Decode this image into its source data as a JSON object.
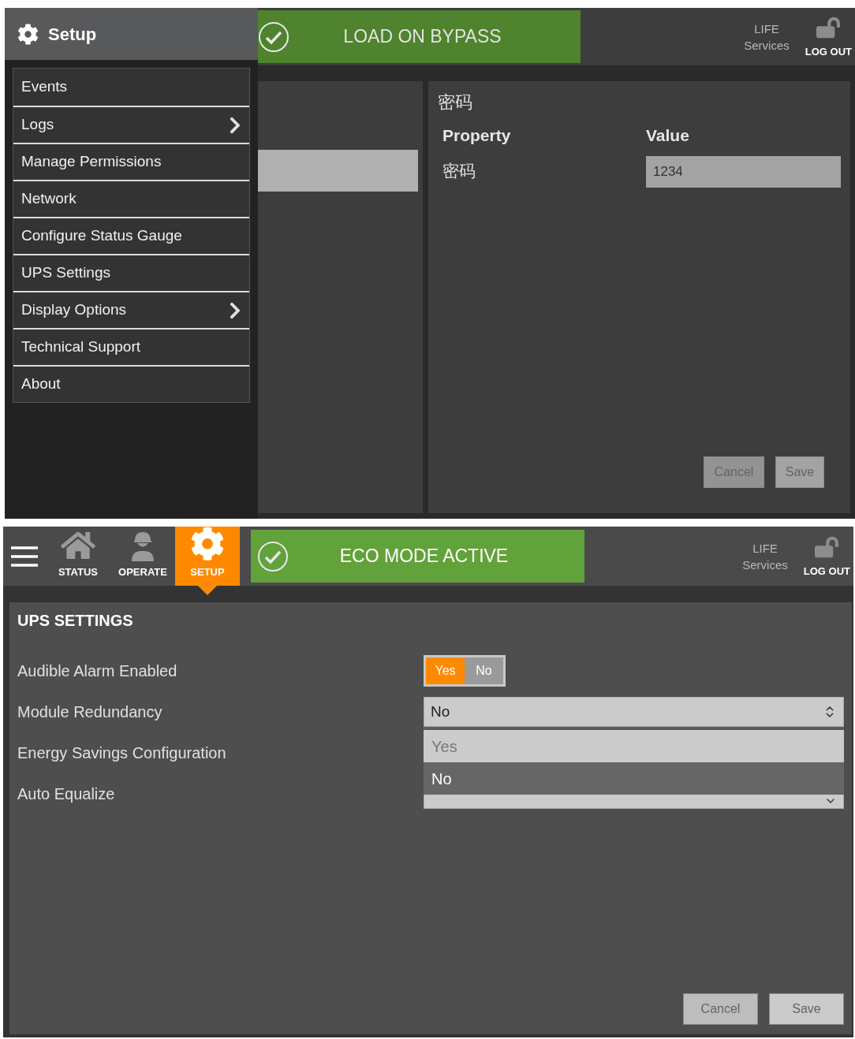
{
  "top_screen": {
    "sidebar": {
      "title": "Setup",
      "items": [
        {
          "label": "Events",
          "submenu": false
        },
        {
          "label": "Logs",
          "submenu": true
        },
        {
          "label": "Manage Permissions",
          "submenu": false
        },
        {
          "label": "Network",
          "submenu": false
        },
        {
          "label": "Configure Status Gauge",
          "submenu": false
        },
        {
          "label": "UPS Settings",
          "submenu": false
        },
        {
          "label": "Display Options",
          "submenu": true
        },
        {
          "label": "Technical Support",
          "submenu": false
        },
        {
          "label": "About",
          "submenu": false
        }
      ]
    },
    "status_banner": {
      "text": "LOAD ON BYPASS"
    },
    "header_right": {
      "brand_line_1": "LIFE",
      "brand_line_2": "Services",
      "logout": "LOG OUT"
    },
    "detail_panel": {
      "title": "密码",
      "columns": [
        "Property",
        "Value"
      ],
      "rows": [
        {
          "property": "密码",
          "value": "1234"
        }
      ],
      "buttons": [
        {
          "label": "Cancel",
          "disabled": true
        },
        {
          "label": "Save",
          "disabled": true
        }
      ]
    }
  },
  "bottom_screen": {
    "nav": [
      {
        "label": "STATUS",
        "kind": "home",
        "selected": false
      },
      {
        "label": "OPERATE",
        "kind": "worker",
        "selected": false
      },
      {
        "label": "SETUP",
        "kind": "gear",
        "selected": true
      }
    ],
    "status_banner": {
      "text": "ECO MODE ACTIVE"
    },
    "header_right": {
      "brand_line_1": "LIFE",
      "brand_line_2": "Services",
      "logout": "LOG OUT"
    },
    "settings": {
      "title": "UPS SETTINGS",
      "rows": [
        {
          "label": "Audible Alarm Enabled",
          "kind": "toggle",
          "options": [
            {
              "label": "Yes",
              "selected": true
            },
            {
              "label": "No",
              "selected": false
            }
          ]
        },
        {
          "label": "Module Redundancy",
          "kind": "select",
          "value": "No",
          "open": true,
          "options": [
            {
              "label": "Yes",
              "selected": false
            },
            {
              "label": "No",
              "selected": true
            }
          ]
        },
        {
          "label": "Energy Savings Configuration",
          "kind": "covered"
        },
        {
          "label": "Auto Equalize",
          "kind": "select"
        }
      ]
    },
    "buttons": [
      {
        "label": "Cancel",
        "disabled": true
      },
      {
        "label": "Save",
        "disabled": true
      }
    ]
  }
}
